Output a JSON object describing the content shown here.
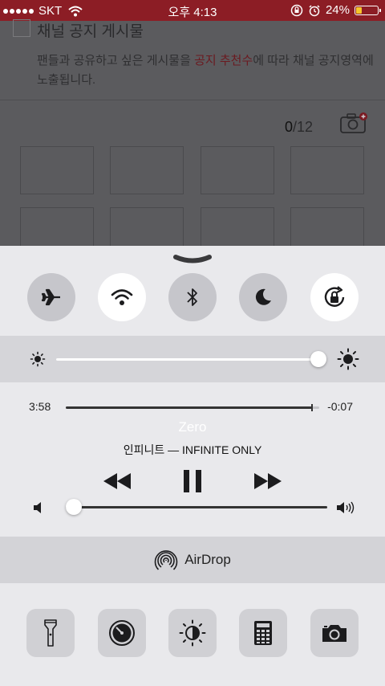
{
  "status_bar": {
    "carrier": "SKT",
    "time": "오후 4:13",
    "battery_percent": "24%",
    "battery_level": 0.24,
    "icons": [
      "signal-dots",
      "wifi-icon",
      "rotation-lock-icon",
      "alarm-icon",
      "battery-icon"
    ]
  },
  "background_app": {
    "section_title": "채널 공지 게시물",
    "description_part1": "팬들과 공유하고 싶은 게시물을 ",
    "description_highlight": "공지 추천수",
    "description_part2": "에 따라 채널 공지영역에 노출됩니다.",
    "photo_count_current": "0",
    "photo_count_max": "/12",
    "highlight_color": "#6b1a20"
  },
  "control_center": {
    "toggles": [
      {
        "name": "airplane-mode",
        "icon": "airplane-icon",
        "state": "off"
      },
      {
        "name": "wifi",
        "icon": "wifi-icon",
        "state": "on"
      },
      {
        "name": "bluetooth",
        "icon": "bluetooth-icon",
        "state": "off"
      },
      {
        "name": "do-not-disturb",
        "icon": "moon-icon",
        "state": "off"
      },
      {
        "name": "rotation-lock",
        "icon": "rotation-lock-icon",
        "state": "on"
      }
    ],
    "brightness": {
      "level": 0.99
    },
    "music": {
      "elapsed": "3:58",
      "remaining": "-0:07",
      "progress": 0.97,
      "title": "Zero",
      "artist_album": "인피니트 — INFINITE ONLY",
      "controls": [
        "rewind-icon",
        "pause-icon",
        "fast-forward-icon"
      ],
      "volume": 0.0
    },
    "airdrop_label": "AirDrop",
    "shortcuts": [
      "flashlight-icon",
      "timer-icon",
      "night-shift-icon",
      "calculator-icon",
      "camera-icon"
    ]
  },
  "colors": {
    "status_bar_bg": "#8c1d25",
    "toggle_on": "#ffffff",
    "toggle_off": "#c6c6cb",
    "slider_fill": "#ffffff",
    "music_slider_fill": "#333333"
  }
}
